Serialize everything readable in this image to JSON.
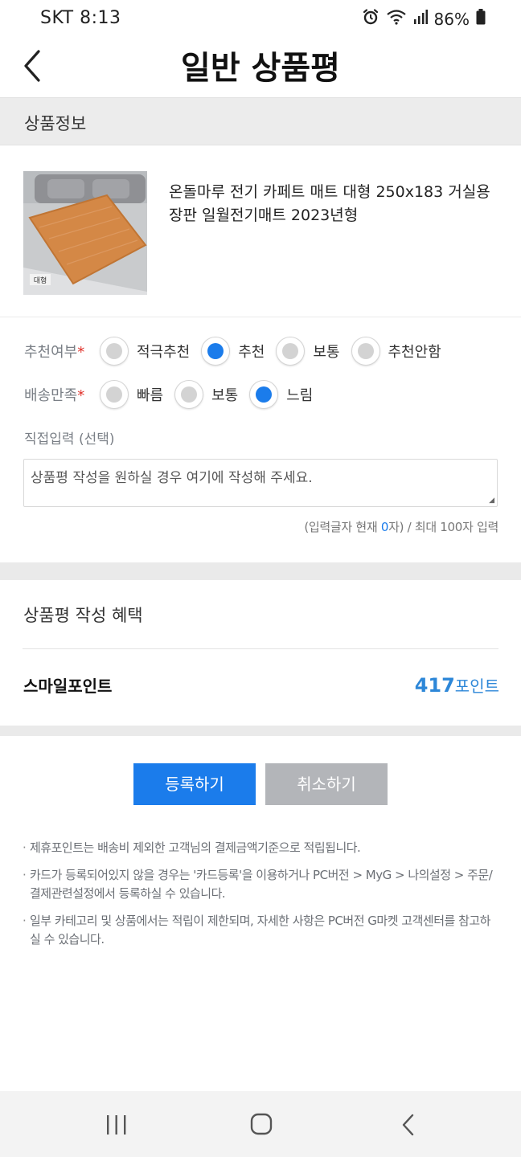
{
  "status_bar": {
    "carrier_time": "SKT 8:13",
    "battery": "86%",
    "icons": [
      "alarm-icon",
      "wifi-icon",
      "signal-icon",
      "battery-icon"
    ]
  },
  "header": {
    "title": "일반 상품평",
    "back_icon": "chevron-left-icon"
  },
  "product_section": {
    "title": "상품정보",
    "product_name": "온돌마루 전기 카페트 매트 대형 250x183 거실용 장판 일월전기매트 2023년형",
    "thumb_badge": "대형"
  },
  "recommend": {
    "label": "추천여부",
    "required_mark": "*",
    "options": [
      {
        "label": "적극추천",
        "selected": false
      },
      {
        "label": "추천",
        "selected": true
      },
      {
        "label": "보통",
        "selected": false
      },
      {
        "label": "추천안함",
        "selected": false
      }
    ]
  },
  "delivery": {
    "label": "배송만족",
    "required_mark": "*",
    "options": [
      {
        "label": "빠름",
        "selected": false
      },
      {
        "label": "보통",
        "selected": false
      },
      {
        "label": "느림",
        "selected": true
      }
    ]
  },
  "direct_input": {
    "label": "직접입력 (선택)",
    "placeholder": "상품평 작성을 원하실 경우 여기에 작성해 주세요.",
    "counter_prefix": "(입력글자 현재 ",
    "counter_value": "0",
    "counter_suffix": "자) / 최대 100자 입력"
  },
  "benefit": {
    "title": "상품평 작성 혜택",
    "smile_label": "스마일포인트",
    "points_value": "417",
    "points_unit": "포인트"
  },
  "buttons": {
    "submit": "등록하기",
    "cancel": "취소하기"
  },
  "notes": [
    "제휴포인트는 배송비 제외한 고객님의 결제금액기준으로 적립됩니다.",
    "카드가 등록되어있지 않을 경우는 '카드등록'을 이용하거나 PC버전 > MyG > 나의설정 > 주문/결제관련설정에서 등록하실 수 있습니다.",
    "일부 카테고리 및 상품에서는 적립이 제한되며, 자세한 사항은 PC버전 G마켓 고객센터를 참고하실 수 있습니다."
  ],
  "colors": {
    "accent": "#1b7ceb",
    "points": "#2d87d8",
    "required": "#e0322b",
    "cancel_button": "#b3b5b9"
  }
}
